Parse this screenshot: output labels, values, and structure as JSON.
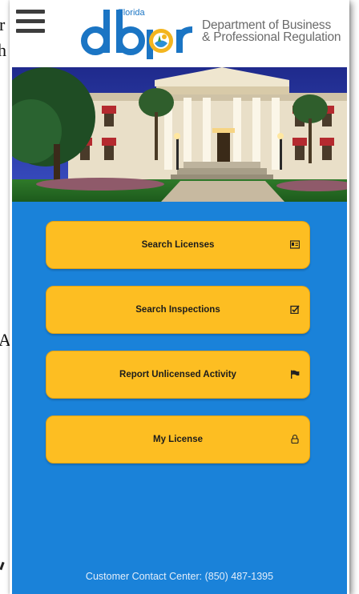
{
  "background_fragments": {
    "frag1": "r",
    "frag2": "h",
    "frag3": "A,"
  },
  "header": {
    "menu_icon": "hamburger-menu-icon",
    "logo": {
      "state_word": "Florida",
      "letters": "dbpr"
    },
    "agency_line1": "Department of Business",
    "agency_line2": "& Professional Regulation"
  },
  "hero": {
    "image": "florida-historic-capitol-photo"
  },
  "nav": {
    "buttons": [
      {
        "label": "Search Licenses",
        "icon": "id-card-icon"
      },
      {
        "label": "Search Inspections",
        "icon": "checkbox-checked-icon"
      },
      {
        "label": "Report Unlicensed Activity",
        "icon": "flag-icon"
      },
      {
        "label": "My License",
        "icon": "lock-icon"
      }
    ]
  },
  "footer": {
    "contact": "Customer Contact Center: (850) 487-1395"
  },
  "colors": {
    "panel_blue": "#1a82d9",
    "button_yellow": "#fdbe22",
    "logo_blue": "#1b75c4",
    "logo_gold": "#f3b51f",
    "menu_gray": "#3d3d3d"
  }
}
